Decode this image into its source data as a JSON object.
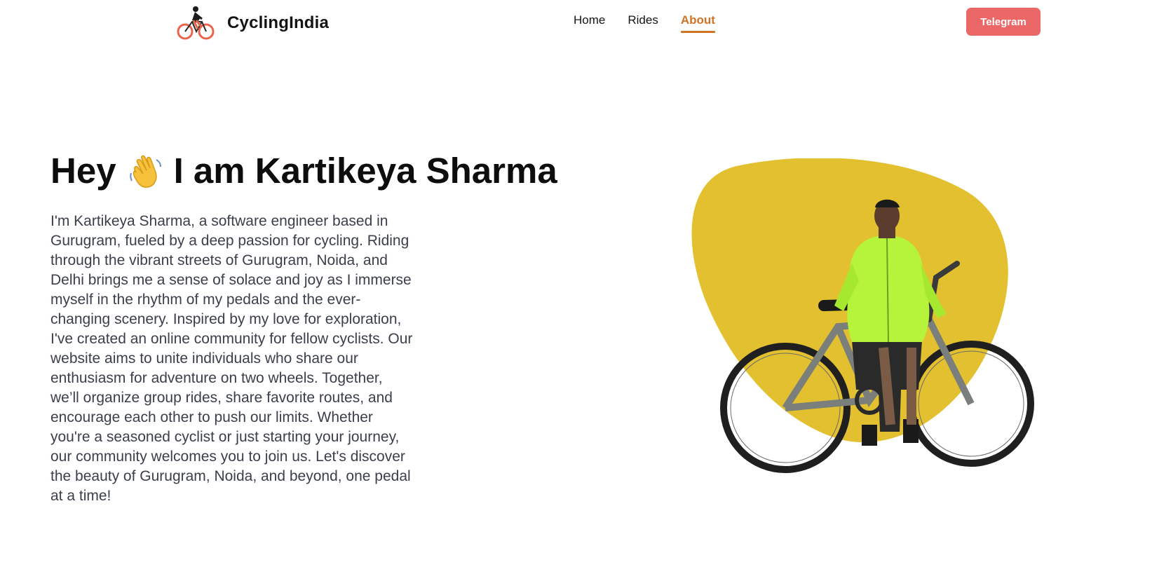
{
  "header": {
    "brand": {
      "name": "CyclingIndia",
      "logo_icon": "cyclist-logo-icon"
    },
    "nav": [
      {
        "label": "Home",
        "active": false
      },
      {
        "label": "Rides",
        "active": false
      },
      {
        "label": "About",
        "active": true
      }
    ],
    "cta": {
      "label": "Telegram",
      "color": "#ec6767"
    },
    "accent_color": "#d07424"
  },
  "hero": {
    "title_before": "Hey",
    "title_emoji_icon": "waving-hand-icon",
    "title_after": "I am Kartikeya Sharma",
    "body": "I'm Kartikeya Sharma, a software engineer based in Gurugram, fueled by a deep passion for cycling. Riding through the vibrant streets of Gurugram, Noida, and Delhi brings me a sense of solace and joy as I immerse myself in the rhythm of my pedals and the ever-changing scenery. Inspired by my love for exploration, I've created an online community for fellow cyclists. Our website aims to unite individuals who share our enthusiasm for adventure on two wheels. Together, we’ll organize group rides, share favorite routes, and encourage each other to push our limits. Whether you're a seasoned cyclist or just starting your journey, our community welcomes you to join us. Let's discover the beauty of Gurugram, Noida, and beyond, one pedal at a time!",
    "illustration": {
      "blob_color": "#e3c02f",
      "jacket_color": "#b5f43a",
      "subject": "cyclist-with-bicycle"
    }
  }
}
